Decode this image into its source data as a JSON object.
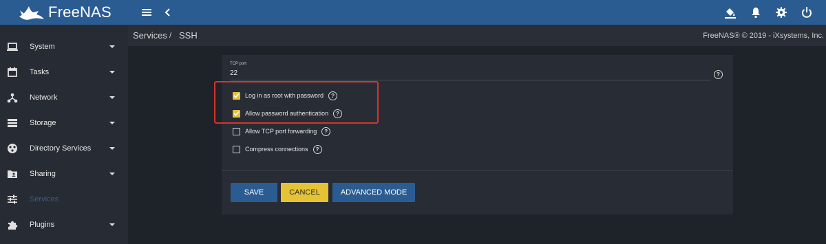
{
  "app": {
    "logo_text": "FreeNAS"
  },
  "topbar": {
    "icons": [
      "menu-icon",
      "back-chevron-icon",
      "theme-bucket-icon",
      "notifications-bell-icon",
      "settings-gear-icon",
      "power-icon"
    ]
  },
  "sidebar": {
    "items": [
      {
        "label": "System",
        "icon": "laptop-icon",
        "expandable": true
      },
      {
        "label": "Tasks",
        "icon": "calendar-icon",
        "expandable": true
      },
      {
        "label": "Network",
        "icon": "network-icon",
        "expandable": true
      },
      {
        "label": "Storage",
        "icon": "storage-icon",
        "expandable": true
      },
      {
        "label": "Directory Services",
        "icon": "directory-icon",
        "expandable": true
      },
      {
        "label": "Sharing",
        "icon": "folder-share-icon",
        "expandable": true
      },
      {
        "label": "Services",
        "icon": "sliders-icon",
        "expandable": false,
        "active": true
      },
      {
        "label": "Plugins",
        "icon": "puzzle-icon",
        "expandable": true
      }
    ]
  },
  "breadcrumb": {
    "parent": "Services",
    "separator": "/",
    "current": "SSH"
  },
  "copyright": "FreeNAS® © 2019 - iXsystems, Inc.",
  "form": {
    "tcp_port": {
      "label": "TCP port",
      "value": "22"
    },
    "checkboxes": [
      {
        "label": "Log in as root with password",
        "checked": true
      },
      {
        "label": "Allow password authentication",
        "checked": true
      },
      {
        "label": "Allow TCP port forwarding",
        "checked": false
      },
      {
        "label": "Compress connections",
        "checked": false
      }
    ],
    "help_glyph": "?"
  },
  "buttons": {
    "save": "SAVE",
    "cancel": "CANCEL",
    "advanced": "ADVANCED MODE"
  },
  "colors": {
    "primary": "#2b5c91",
    "accent": "#e6c334",
    "annotation": "#d9322b"
  }
}
